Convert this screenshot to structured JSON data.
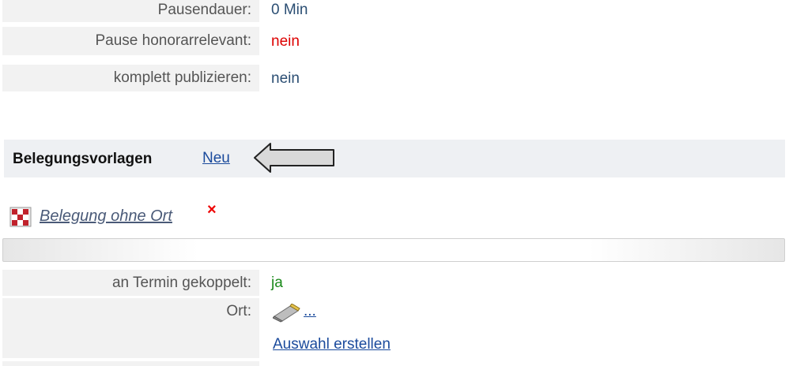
{
  "rows_top": [
    {
      "label": "Pausendauer:",
      "value": "0 Min",
      "color": "#2b4e73"
    },
    {
      "label": "Pause honorarrelevant:",
      "value": "nein",
      "color": "#dd0000"
    },
    {
      "label": "komplett publizieren:",
      "value": "nein",
      "color": "#2b4e73"
    }
  ],
  "section": {
    "title": "Belegungsvorlagen",
    "new_link": "Neu"
  },
  "template": {
    "name": "Belegung ohne Ort",
    "delete_glyph": "×"
  },
  "details": {
    "coupled_label": "an Termin gekoppelt:",
    "coupled_value": "ja",
    "ort_label": "Ort:",
    "ort_link": "...",
    "ort_create": "Auswahl erstellen"
  },
  "icons": {
    "template_icon": "checkered-template-icon",
    "ort_icon": "pencil-eraser-icon",
    "arrow": "left-arrow-annotation"
  }
}
